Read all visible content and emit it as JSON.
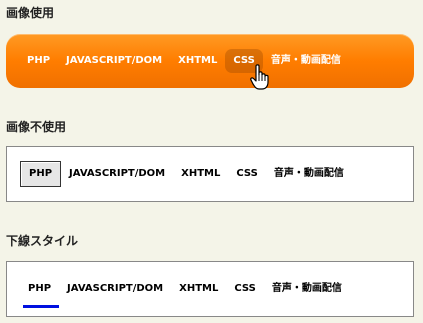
{
  "sections": [
    {
      "title": "画像使用",
      "items": [
        "PHP",
        "JAVASCRIPT/DOM",
        "XHTML",
        "CSS",
        "音声・動画配信"
      ],
      "active": "CSS",
      "accent": "#ff7d00"
    },
    {
      "title": "画像不使用",
      "items": [
        "PHP",
        "JAVASCRIPT/DOM",
        "XHTML",
        "CSS",
        "音声・動画配信"
      ],
      "active": "PHP"
    },
    {
      "title": "下線スタイル",
      "items": [
        "PHP",
        "JAVASCRIPT/DOM",
        "XHTML",
        "CSS",
        "音声・動画配信"
      ],
      "active": "PHP",
      "underline_color": "#0010e0"
    }
  ],
  "cursor_icon": "hand-pointer-icon"
}
